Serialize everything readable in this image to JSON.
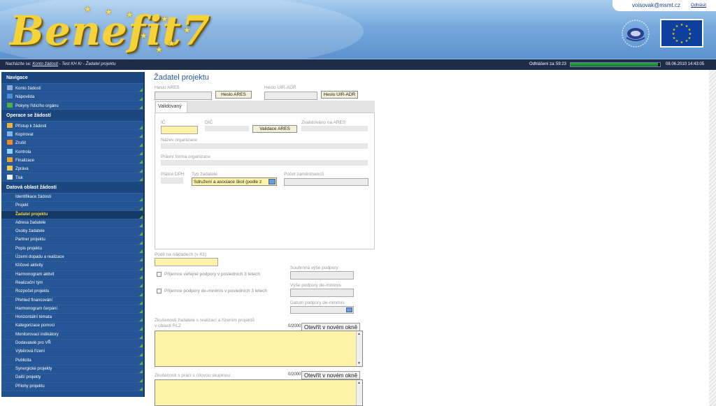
{
  "header": {
    "logo_text": "Benefit7",
    "user_email": "voisovak@msmt.cz",
    "logout_link": "Odhlásit",
    "ministry_logo": "Ministerstvo školství mládeže a tělovýchovy",
    "eu_flag_icon": "eu-flag-icon"
  },
  "statusbar": {
    "location_label": "Nacházíte se:",
    "breadcrumb": [
      "Konto žádostí",
      "Test KH Kr",
      "Žadatel projektu"
    ],
    "logout_label": "Odhlášení za:",
    "logout_timer": "59:23",
    "session_remaining_fraction": 0.98,
    "datetime": "08.06.2010   14:43:05"
  },
  "sidebar": {
    "sections": [
      {
        "title": "Navigace",
        "items": [
          {
            "label": "Konto žádostí",
            "icon": "list-icon",
            "color": "#8aa9d6"
          },
          {
            "label": "Nápověda",
            "icon": "help-icon",
            "color": "#4f8bd6"
          },
          {
            "label": "Pokyny řídícího orgánu",
            "icon": "info-icon",
            "color": "#52b043"
          }
        ]
      },
      {
        "title": "Operace se žádostí",
        "items": [
          {
            "label": "Přístup k žádosti",
            "icon": "users-icon",
            "color": "#e9b23a"
          },
          {
            "label": "Kopírovat",
            "icon": "copy-icon",
            "color": "#7fb6ea"
          },
          {
            "label": "Zrušit",
            "icon": "cancel-icon",
            "color": "#f08a22"
          },
          {
            "label": "Kontrola",
            "icon": "check-icon",
            "color": "#8fd0ff"
          },
          {
            "label": "Finalizace",
            "icon": "lock-icon",
            "color": "#e8a22a"
          },
          {
            "label": "Zpráva",
            "icon": "mail-icon",
            "color": "#f2c94c"
          },
          {
            "label": "Tisk",
            "icon": "print-icon",
            "color": "#f2f2f2"
          }
        ]
      },
      {
        "title": "Datová oblast žádosti",
        "items": [
          {
            "label": "Identifikace žádosti"
          },
          {
            "label": "Projekt"
          },
          {
            "label": "Žadatel projektu",
            "active": true
          },
          {
            "label": "Adresa žadatele"
          },
          {
            "label": "Osoby žadatele"
          },
          {
            "label": "Partner projektu"
          },
          {
            "label": "Popis projektu"
          },
          {
            "label": "Území dopadu a realizace"
          },
          {
            "label": "Klíčové aktivity"
          },
          {
            "label": "Harmonogram aktivit"
          },
          {
            "label": "Realizační tým"
          },
          {
            "label": "Rozpočet projektu"
          },
          {
            "label": "Přehled financování"
          },
          {
            "label": "Harmonogram čerpání"
          },
          {
            "label": "Horizontální témata"
          },
          {
            "label": "Kategorizace pomoci"
          },
          {
            "label": "Monitorovací indikátory"
          },
          {
            "label": "Dodavatelé pro VŘ"
          },
          {
            "label": "Výběrová řízení"
          },
          {
            "label": "Publicita"
          },
          {
            "label": "Synergické projekty"
          },
          {
            "label": "Další projekty"
          },
          {
            "label": "Přílohy projektu"
          }
        ]
      }
    ]
  },
  "main": {
    "title": "Žadatel projektu",
    "heslo_ares_label": "Heslo ARES",
    "heslo_ares_button": "Heslo ARES",
    "heslo_uir_label": "Heslo UIR-ADR",
    "heslo_uir_button": "Heslo UIR-ADR",
    "tab_label": "Validovaný",
    "ic_label": "IČ",
    "dic_label": "DIČ",
    "validace_button": "Validace ARES",
    "zvalidovano_label": "Zvalidováno na ARES",
    "nazev_label": "Název organizace",
    "pravni_forma_label": "Právní forma organizace",
    "platce_dph_label": "Plátce DPH",
    "typ_zadatele_label": "Typ žadatele",
    "typ_zadatele_value": "Sdružení a asociace škol (podle z",
    "pocet_zamestnancu_label": "Počet zaměstnanců",
    "podil_label": "Podíl na nákladech (v Kč)",
    "souhrnna_label": "Souhrnná výše podpory",
    "prijemce_verejne_label": "Příjemce veřejné podpory v posledních 3 letech",
    "vyse_deminimis_label": "Výše podpory de-minimis",
    "prijemce_deminimis_label": "Příjemce podpory de-minimis v posledních 3 letech",
    "datum_deminimis_label": "Datum podpory de-minimis",
    "zkusenosti_rlz_label_1": "Zkušenosti žadatele s realizací a řízením projektů",
    "zkusenosti_rlz_label_2": "v oblasti RLZ",
    "zkusenosti_rlz_counter": "0/2000",
    "open_new_window": "Otevřít v novém okně",
    "zkusenosti_cilova_label": "Zkušenosti s prací s cílovou skupinou",
    "zkusenosti_cilova_counter": "0/2000"
  }
}
